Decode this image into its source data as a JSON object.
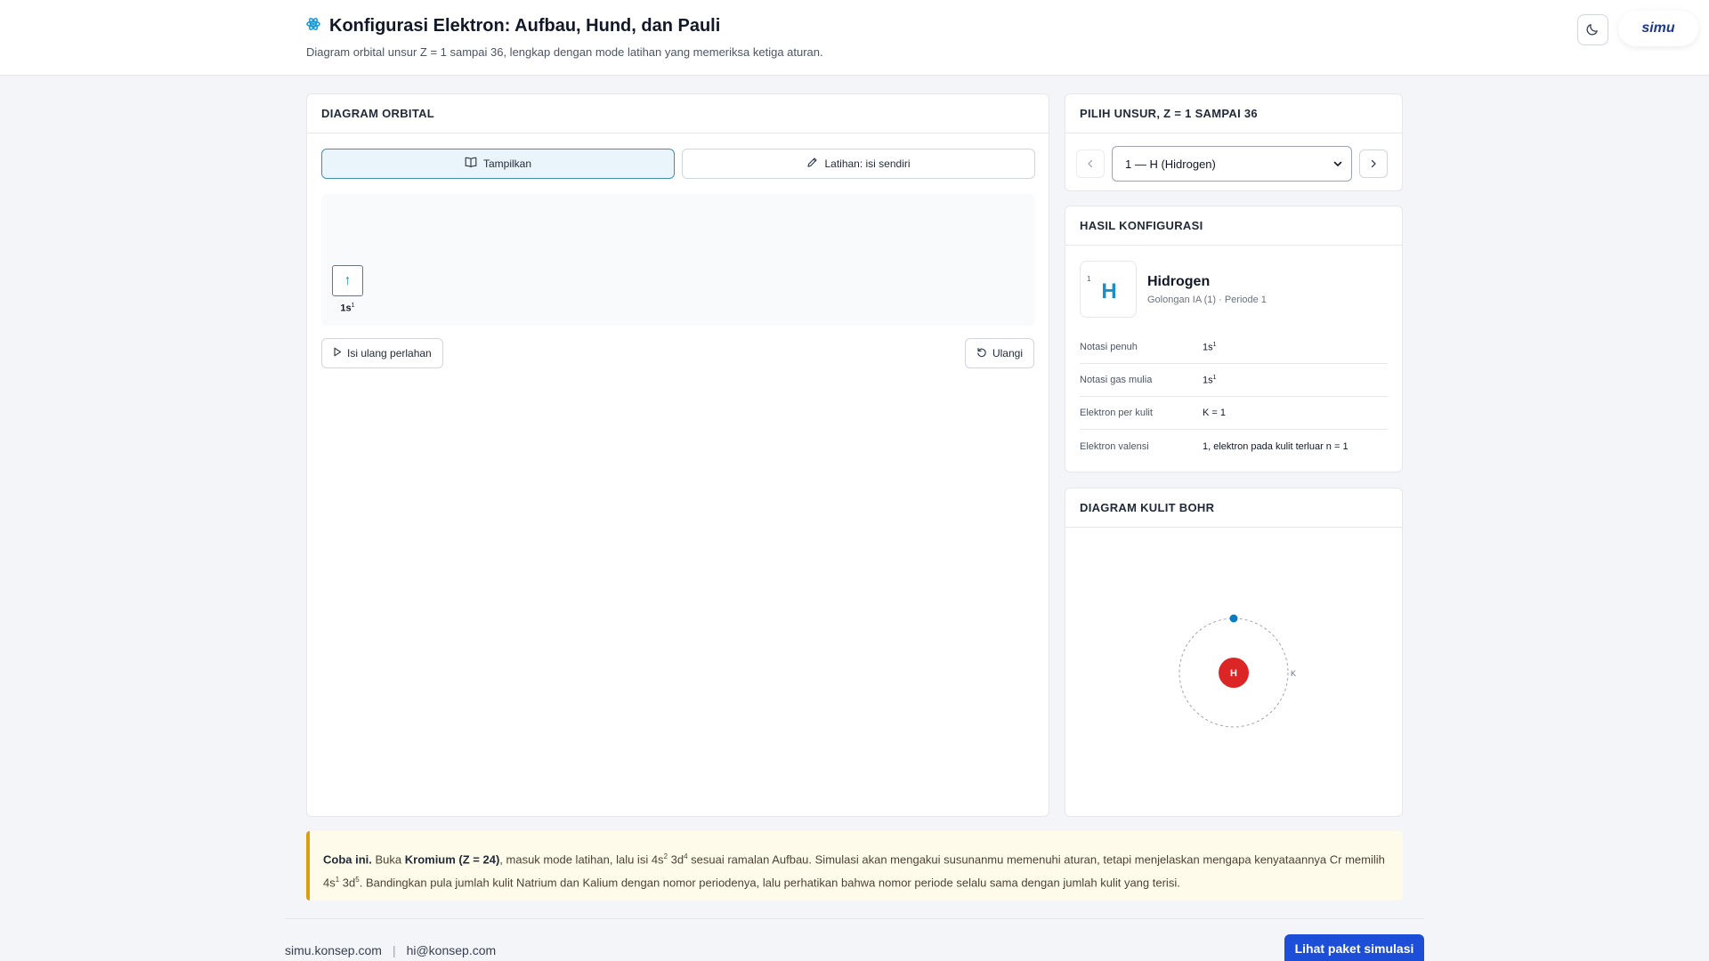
{
  "header": {
    "title": "Konfigurasi Elektron: Aufbau, Hund, dan Pauli",
    "subtitle": "Diagram orbital unsur Z = 1 sampai 36, lengkap dengan mode latihan yang memeriksa ketiga aturan.",
    "title_icon": "atom-icon",
    "theme_icon": "moon-icon",
    "brand": "simu"
  },
  "orbital_panel": {
    "heading": "DIAGRAM ORBITAL",
    "tabs": [
      {
        "label": "Tampilkan",
        "icon": "book-icon",
        "active": true
      },
      {
        "label": "Latihan: isi sendiri",
        "icon": "pencil-icon",
        "active": false
      }
    ],
    "orbitals": [
      {
        "label": "1s",
        "electrons": "1",
        "arrow": "↑"
      }
    ],
    "replay_label": "Isi ulang perlahan",
    "reset_label": "Ulangi"
  },
  "element_picker": {
    "heading": "PILIH UNSUR, Z = 1 SAMPAI 36",
    "selected": "1 — H (Hidrogen)"
  },
  "result": {
    "heading": "HASIL KONFIGURASI",
    "atomic_number": "1",
    "symbol": "H",
    "name": "Hidrogen",
    "group_period": "Golongan IA (1) · Periode 1",
    "rows": [
      {
        "key": "Notasi penuh",
        "val": "1s",
        "sup": "1"
      },
      {
        "key": "Notasi gas mulia",
        "val": "1s",
        "sup": "1"
      },
      {
        "key": "Elektron per kulit",
        "val": "K = 1",
        "sup": ""
      },
      {
        "key": "Elektron valensi",
        "val": "1, elektron pada kulit terluar n = 1",
        "sup": ""
      }
    ]
  },
  "bohr": {
    "heading": "DIAGRAM KULIT BOHR",
    "nucleus": "H",
    "shell_label": "K",
    "electrons": 1,
    "nucleus_color": "#dc2626",
    "electron_color": "#0b7bbf"
  },
  "tip": {
    "lead": "Coba ini.",
    "t1": " Buka ",
    "element": "Kromium (Z = 24)",
    "t2": ", masuk mode latihan, lalu isi 4s",
    "s1": "2",
    "t3": " 3d",
    "s2": "4",
    "t4": " sesuai ramalan Aufbau. Simulasi akan mengakui susunanmu memenuhi aturan, tetapi menjelaskan mengapa kenyataannya Cr memilih 4s",
    "s3": "1",
    "t5": " 3d",
    "s4": "5",
    "t6": ". Bandingkan pula jumlah kulit Natrium dan Kalium dengan nomor periodenya, lalu perhatikan bahwa nomor periode selalu sama dengan jumlah kulit yang terisi."
  },
  "footer": {
    "site": "simu.konsep.com",
    "separator": "|",
    "email": "hi@konsep.com",
    "cta": "Lihat paket simulasi"
  }
}
